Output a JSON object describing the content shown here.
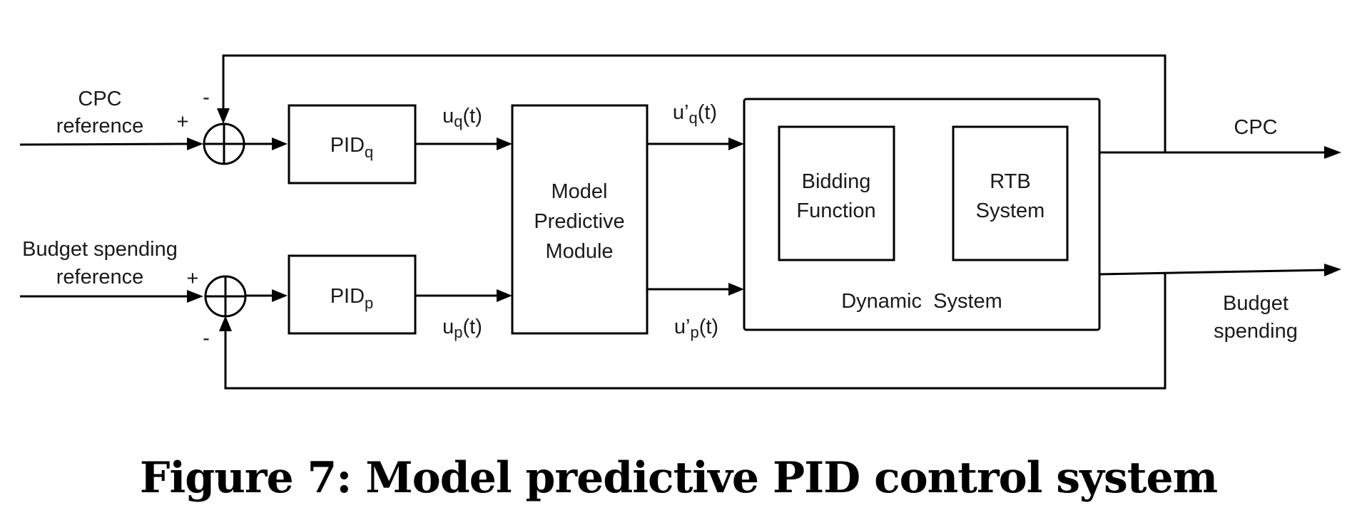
{
  "inputs": {
    "cpc_reference": [
      "CPC",
      "reference"
    ],
    "budget_reference": [
      "Budget spending",
      "reference"
    ]
  },
  "signs": {
    "upper_plus": "+",
    "upper_minus": "-",
    "lower_plus": "+",
    "lower_minus": "-"
  },
  "blocks": {
    "pid_q": {
      "main": "PID",
      "sub": "q"
    },
    "pid_p": {
      "main": "PID",
      "sub": "p"
    },
    "mpc": [
      "Model",
      "Predictive",
      "Module"
    ],
    "bidding": [
      "Bidding",
      "Function"
    ],
    "rtb": [
      "RTB",
      "System"
    ],
    "dynamic": "Dynamic  System"
  },
  "signals": {
    "uq": {
      "pre": "u",
      "sub": "q",
      "post": "(t)"
    },
    "up": {
      "pre": "u",
      "sub": "p",
      "post": "(t)"
    },
    "uq_prime": {
      "pre": "u’",
      "sub": "q",
      "post": "(t)"
    },
    "up_prime": {
      "pre": "u’",
      "sub": "p",
      "post": "(t)"
    }
  },
  "outputs": {
    "cpc": "CPC",
    "budget": [
      "Budget",
      "spending"
    ]
  },
  "caption": "Figure 7: Model predictive PID control system"
}
